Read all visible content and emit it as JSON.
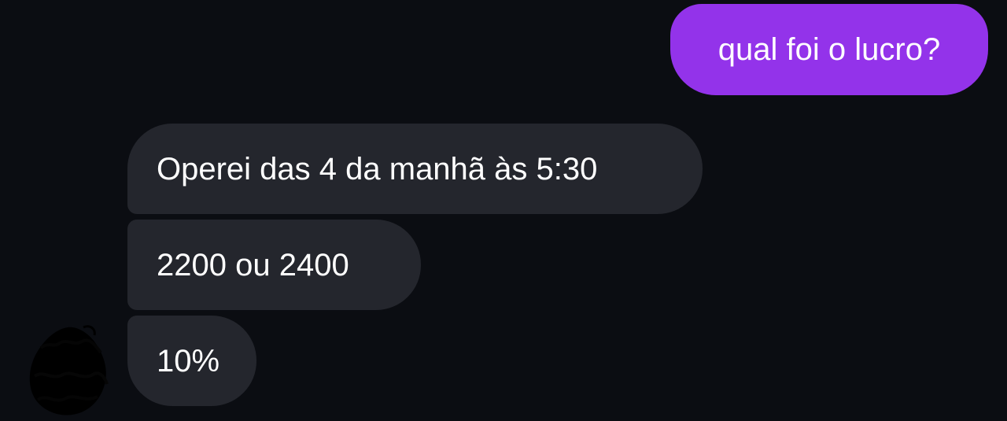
{
  "conversation": {
    "outgoing": [
      {
        "text": "qual foi o lucro?"
      }
    ],
    "incoming": [
      {
        "text": "Operei das 4 da manhã às 5:30"
      },
      {
        "text": "2200 ou 2400"
      },
      {
        "text": "10%"
      }
    ],
    "sender_avatar": {
      "icon": "redacted-avatar-icon"
    }
  },
  "colors": {
    "background": "#0b0d12",
    "outgoing_bubble": "#9333ea",
    "incoming_bubble": "#24262d",
    "text": "#ffffff"
  }
}
